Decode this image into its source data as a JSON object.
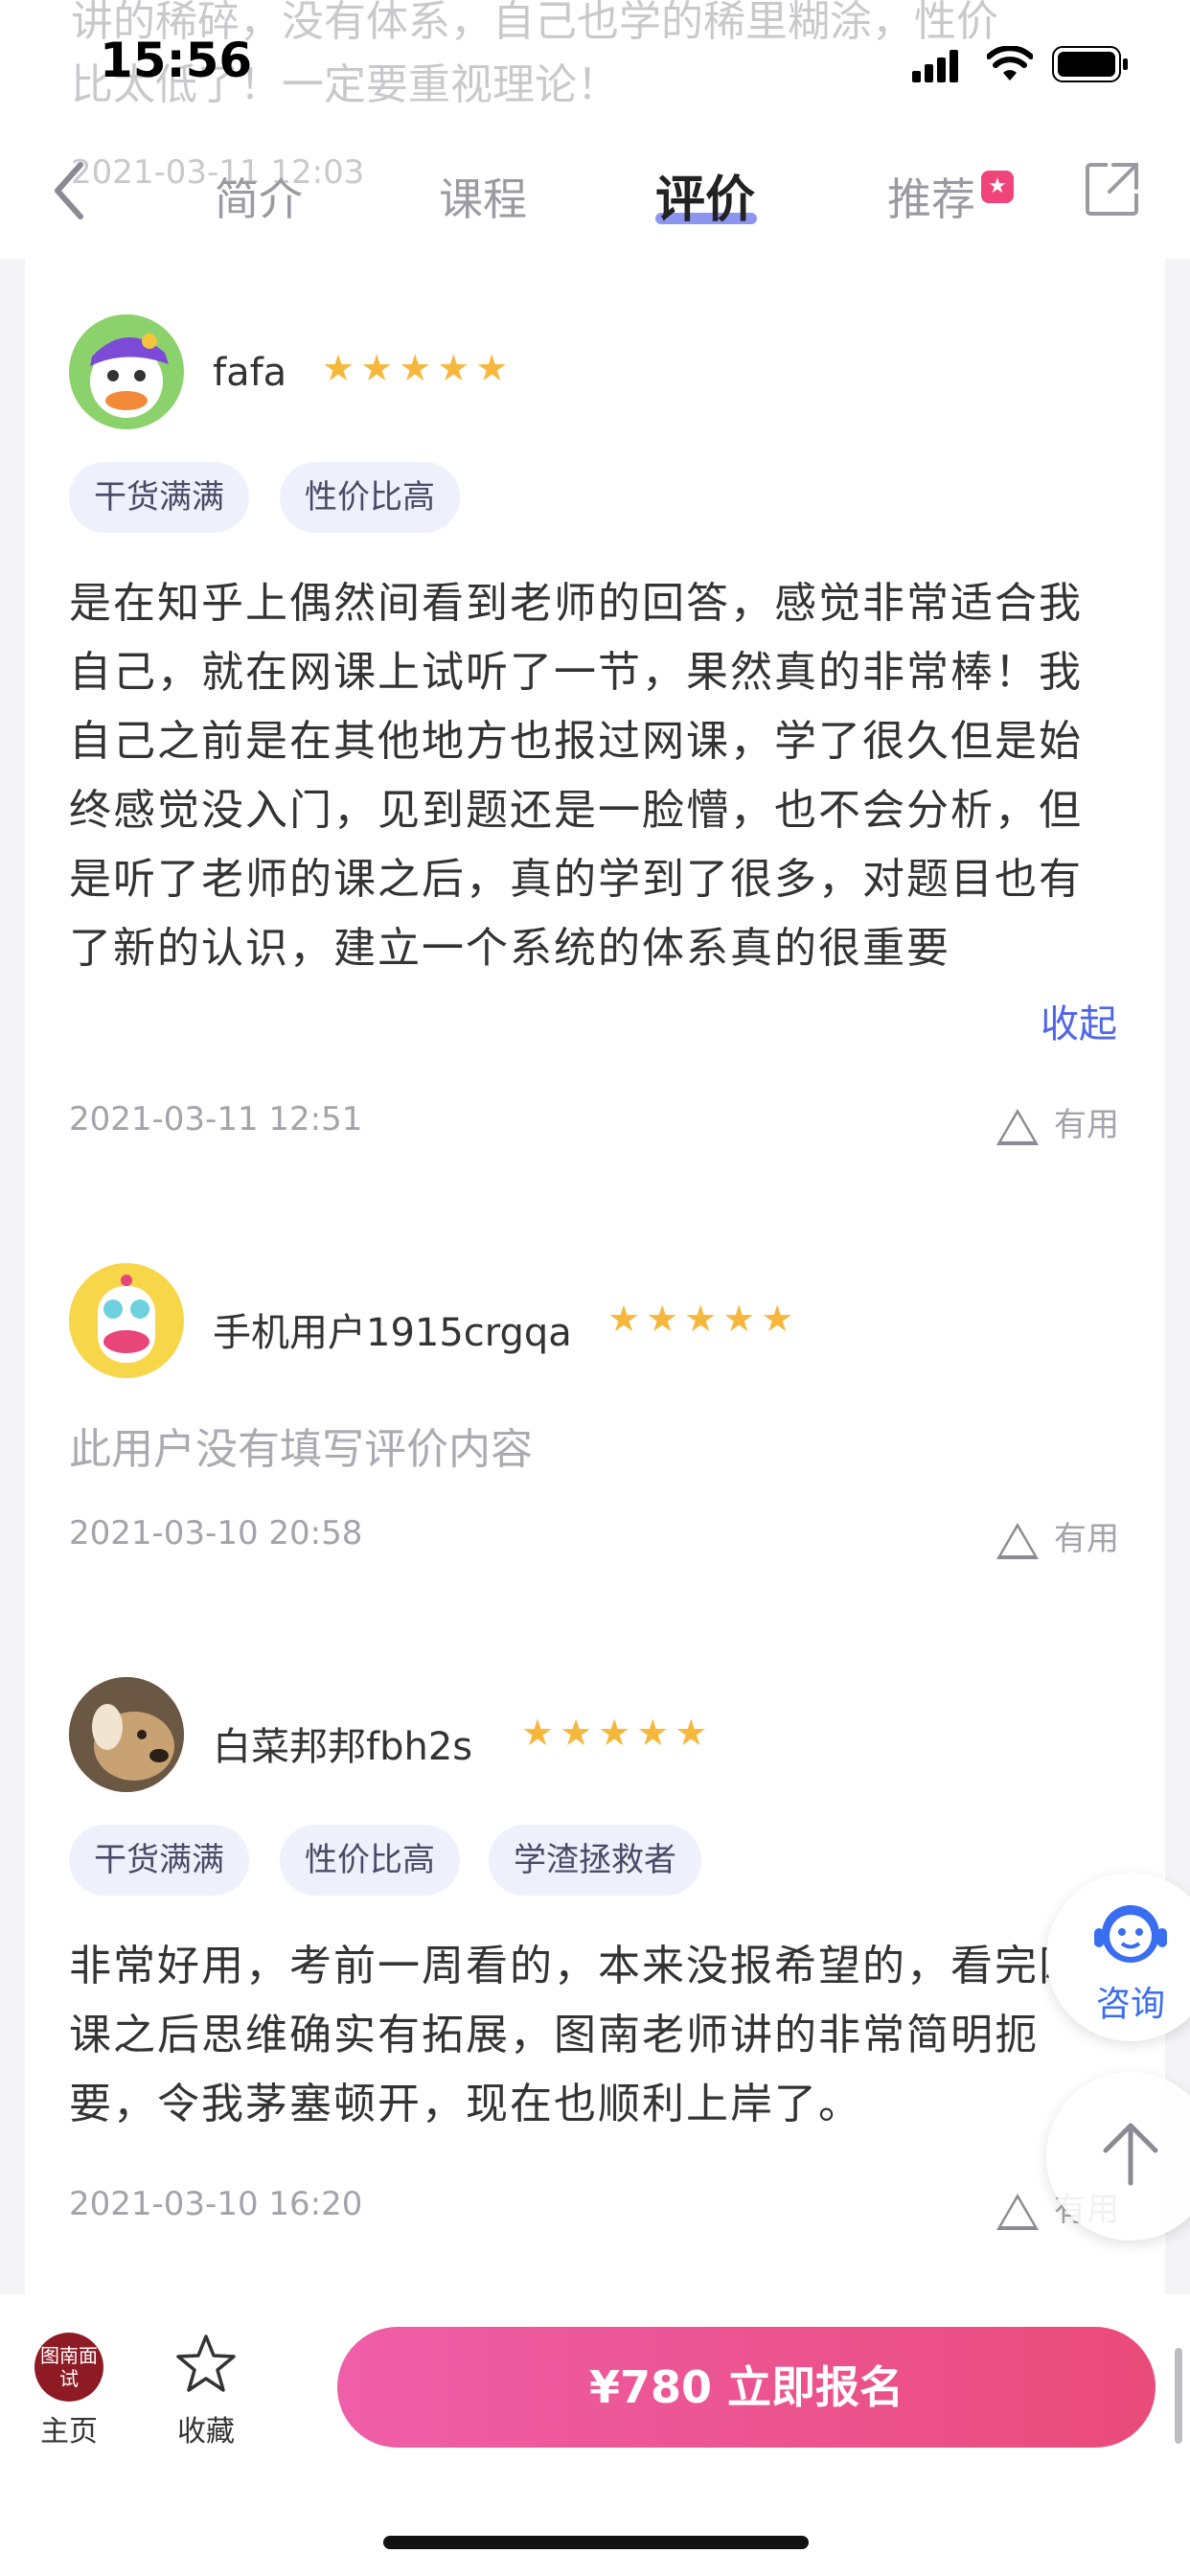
{
  "status_bar": {
    "time": "15:56"
  },
  "background_preview": {
    "line1": "讲的稀碎，没有体系，自己也学的稀里糊涂，性价",
    "line2": "比太低了！一定要重视理论！",
    "line3": "2021-03-11 12:03"
  },
  "header": {
    "tabs": [
      {
        "label": "简介"
      },
      {
        "label": "课程"
      },
      {
        "label": "评价"
      },
      {
        "label": "推荐"
      }
    ],
    "recommend_badge": "★"
  },
  "reviews": [
    {
      "name": "fafa",
      "stars": "★★★★★",
      "tags": [
        "干货满满",
        "性价比高"
      ],
      "text": "是在知乎上偶然间看到老师的回答，感觉非常适合我自己，就在网课上试听了一节，果然真的非常棒！我自己之前是在其他地方也报过网课，学了很久但是始终感觉没入门，见到题还是一脸懵，也不会分析，但是听了老师的课之后，真的学到了很多，对题目也有了新的认识，建立一个系统的体系真的很重要",
      "collapse": "收起",
      "date": "2021-03-11 12:51",
      "useful": "有用"
    },
    {
      "name": "手机用户1915crgqa",
      "stars": "★★★★★",
      "empty_text": "此用户没有填写评价内容",
      "date": "2021-03-10 20:58",
      "useful": "有用"
    },
    {
      "name": "白菜邦邦fbh2s",
      "stars": "★★★★★",
      "tags": [
        "干货满满",
        "性价比高",
        "学渣拯救者"
      ],
      "text": "非常好用，考前一周看的，本来没报希望的，看完网课之后思维确实有拓展，图南老师讲的非常简明扼要，令我茅塞顿开，现在也顺利上岸了。",
      "date": "2021-03-10 16:20",
      "useful": "有用"
    }
  ],
  "floating": {
    "consult_label": "咨询"
  },
  "bottom_bar": {
    "logo_text": "图南面试",
    "home_label": "主页",
    "favorite_label": "收藏",
    "cta_label": "¥780  立即报名"
  }
}
